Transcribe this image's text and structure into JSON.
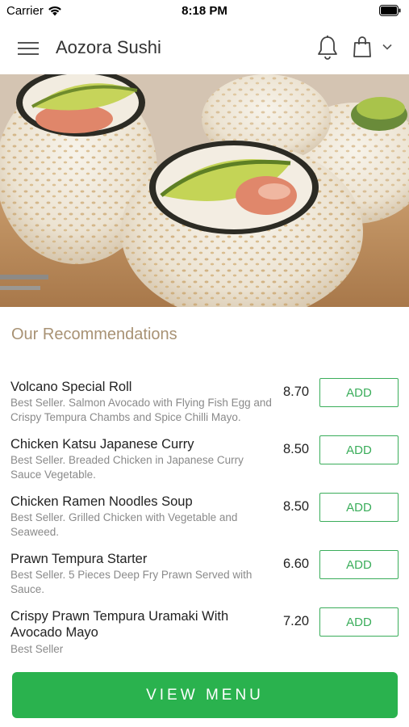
{
  "status_bar": {
    "carrier": "Carrier",
    "time": "8:18 PM"
  },
  "header": {
    "title": "Aozora Sushi"
  },
  "section": {
    "title": "Our Recommendations"
  },
  "menu_items": [
    {
      "name": "Volcano Special Roll",
      "description": "Best Seller. Salmon Avocado with Flying Fish Egg and Crispy Tempura Chambs and Spice Chilli Mayo.",
      "price": "8.70",
      "add_label": "ADD"
    },
    {
      "name": "Chicken Katsu Japanese Curry",
      "description": "Best Seller. Breaded Chicken in Japanese Curry Sauce Vegetable.",
      "price": "8.50",
      "add_label": "ADD"
    },
    {
      "name": "Chicken Ramen Noodles Soup",
      "description": "Best Seller. Grilled Chicken with Vegetable and Seaweed.",
      "price": "8.50",
      "add_label": "ADD"
    },
    {
      "name": "Prawn Tempura Starter",
      "description": "Best Seller. 5 Pieces Deep Fry Prawn Served with Sauce.",
      "price": "6.60",
      "add_label": "ADD"
    },
    {
      "name": "Crispy Prawn Tempura Uramaki With Avocado Mayo",
      "description": "Best Seller",
      "price": "7.20",
      "add_label": "ADD"
    }
  ],
  "footer": {
    "view_menu_label": "VIEW MENU"
  },
  "colors": {
    "accent_green": "#2ab24e",
    "section_title": "#a89274"
  },
  "icons": [
    "wifi-icon",
    "battery-icon",
    "menu-icon",
    "bell-icon",
    "shopping-bag-icon",
    "chevron-down-icon"
  ]
}
